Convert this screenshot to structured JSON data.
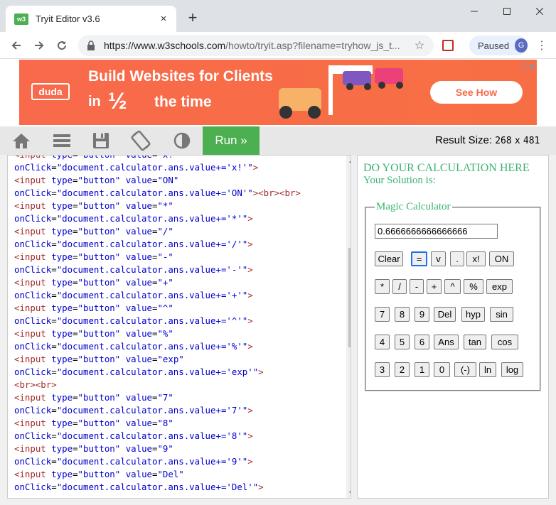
{
  "browser": {
    "tab_title": "Tryit Editor v3.6",
    "favicon_text": "w3",
    "tab_close": "×",
    "new_tab": "+",
    "url_host": "https://www.w3schools.com",
    "url_path": "/howto/tryit.asp?filename=tryhow_js_t...",
    "profile_label": "Paused",
    "profile_initial": "G",
    "icons": [
      "back-icon",
      "forward-icon",
      "reload-icon",
      "lock-icon",
      "star-icon",
      "extension-icon",
      "menu-icon",
      "minimize-icon",
      "maximize-icon",
      "close-icon"
    ]
  },
  "ad": {
    "logo": "duda",
    "line1": "Build Websites for Clients",
    "in": "in",
    "half": "½",
    "rest": "the time",
    "cta": "See How",
    "info": "ⓘ✕",
    "color": "#f86e44"
  },
  "tryit": {
    "run_label": "Run »",
    "result_size_label": "Result Size:",
    "result_width": "268",
    "result_x": "x",
    "result_height": "481",
    "accent": "#4caf50",
    "icons": [
      "home-icon",
      "menu-icon",
      "save-icon",
      "rotate-icon",
      "contrast-icon"
    ]
  },
  "code_lines": [
    [
      [
        "c-tag",
        "<input "
      ],
      [
        "c-attr",
        "type"
      ],
      [
        "c-plain",
        "="
      ],
      [
        "c-attr",
        "\"button\""
      ],
      [
        "c-plain",
        " "
      ],
      [
        "c-attr",
        "value"
      ],
      [
        "c-plain",
        "="
      ],
      [
        "c-attr",
        "\"x!\""
      ]
    ],
    [
      [
        "c-attr",
        "onClick"
      ],
      [
        "c-plain",
        "="
      ],
      [
        "c-attr",
        "\"document.calculator.ans.value+='x!'\""
      ],
      [
        "c-tag",
        ">"
      ]
    ],
    [
      [
        "c-tag",
        "<input "
      ],
      [
        "c-attr",
        "type"
      ],
      [
        "c-plain",
        "="
      ],
      [
        "c-attr",
        "\"button\""
      ],
      [
        "c-plain",
        " "
      ],
      [
        "c-attr",
        "value"
      ],
      [
        "c-plain",
        "="
      ],
      [
        "c-attr",
        "\"ON\""
      ]
    ],
    [
      [
        "c-attr",
        "onClick"
      ],
      [
        "c-plain",
        "="
      ],
      [
        "c-attr",
        "\"document.calculator.ans.value+='ON'\""
      ],
      [
        "c-tag",
        "><br><br>"
      ]
    ],
    [
      [
        "c-tag",
        "<input "
      ],
      [
        "c-attr",
        "type"
      ],
      [
        "c-plain",
        "="
      ],
      [
        "c-attr",
        "\"button\""
      ],
      [
        "c-plain",
        " "
      ],
      [
        "c-attr",
        "value"
      ],
      [
        "c-plain",
        "="
      ],
      [
        "c-attr",
        "\"*\""
      ]
    ],
    [
      [
        "c-attr",
        "onClick"
      ],
      [
        "c-plain",
        "="
      ],
      [
        "c-attr",
        "\"document.calculator.ans.value+='*'\""
      ],
      [
        "c-tag",
        ">"
      ]
    ],
    [
      [
        "c-tag",
        "<input "
      ],
      [
        "c-attr",
        "type"
      ],
      [
        "c-plain",
        "="
      ],
      [
        "c-attr",
        "\"button\""
      ],
      [
        "c-plain",
        " "
      ],
      [
        "c-attr",
        "value"
      ],
      [
        "c-plain",
        "="
      ],
      [
        "c-attr",
        "\"/\""
      ]
    ],
    [
      [
        "c-attr",
        "onClick"
      ],
      [
        "c-plain",
        "="
      ],
      [
        "c-attr",
        "\"document.calculator.ans.value+='/'\""
      ],
      [
        "c-tag",
        ">"
      ]
    ],
    [
      [
        "c-tag",
        "<input "
      ],
      [
        "c-attr",
        "type"
      ],
      [
        "c-plain",
        "="
      ],
      [
        "c-attr",
        "\"button\""
      ],
      [
        "c-plain",
        " "
      ],
      [
        "c-attr",
        "value"
      ],
      [
        "c-plain",
        "="
      ],
      [
        "c-attr",
        "\"-\""
      ]
    ],
    [
      [
        "c-attr",
        "onClick"
      ],
      [
        "c-plain",
        "="
      ],
      [
        "c-attr",
        "\"document.calculator.ans.value+='-'\""
      ],
      [
        "c-tag",
        ">"
      ]
    ],
    [
      [
        "c-tag",
        "<input "
      ],
      [
        "c-attr",
        "type"
      ],
      [
        "c-plain",
        "="
      ],
      [
        "c-attr",
        "\"button\""
      ],
      [
        "c-plain",
        " "
      ],
      [
        "c-attr",
        "value"
      ],
      [
        "c-plain",
        "="
      ],
      [
        "c-attr",
        "\"+\""
      ]
    ],
    [
      [
        "c-attr",
        "onClick"
      ],
      [
        "c-plain",
        "="
      ],
      [
        "c-attr",
        "\"document.calculator.ans.value+='+'\""
      ],
      [
        "c-tag",
        ">"
      ]
    ],
    [
      [
        "c-tag",
        "<input "
      ],
      [
        "c-attr",
        "type"
      ],
      [
        "c-plain",
        "="
      ],
      [
        "c-attr",
        "\"button\""
      ],
      [
        "c-plain",
        " "
      ],
      [
        "c-attr",
        "value"
      ],
      [
        "c-plain",
        "="
      ],
      [
        "c-attr",
        "\"^\""
      ]
    ],
    [
      [
        "c-attr",
        "onClick"
      ],
      [
        "c-plain",
        "="
      ],
      [
        "c-attr",
        "\"document.calculator.ans.value+='^'\""
      ],
      [
        "c-tag",
        ">"
      ]
    ],
    [
      [
        "c-tag",
        "<input "
      ],
      [
        "c-attr",
        "type"
      ],
      [
        "c-plain",
        "="
      ],
      [
        "c-attr",
        "\"button\""
      ],
      [
        "c-plain",
        " "
      ],
      [
        "c-attr",
        "value"
      ],
      [
        "c-plain",
        "="
      ],
      [
        "c-attr",
        "\"%\""
      ]
    ],
    [
      [
        "c-attr",
        "onClick"
      ],
      [
        "c-plain",
        "="
      ],
      [
        "c-attr",
        "\"document.calculator.ans.value+='%'\""
      ],
      [
        "c-tag",
        ">"
      ]
    ],
    [
      [
        "c-tag",
        "<input "
      ],
      [
        "c-attr",
        "type"
      ],
      [
        "c-plain",
        "="
      ],
      [
        "c-attr",
        "\"button\""
      ],
      [
        "c-plain",
        " "
      ],
      [
        "c-attr",
        "value"
      ],
      [
        "c-plain",
        "="
      ],
      [
        "c-attr",
        "\"exp\""
      ]
    ],
    [
      [
        "c-attr",
        "onClick"
      ],
      [
        "c-plain",
        "="
      ],
      [
        "c-attr",
        "\"document.calculator.ans.value+='exp'\""
      ],
      [
        "c-tag",
        ">"
      ]
    ],
    [
      [
        "c-tag",
        "<br><br>"
      ]
    ],
    [
      [
        "c-tag",
        "<input "
      ],
      [
        "c-attr",
        "type"
      ],
      [
        "c-plain",
        "="
      ],
      [
        "c-attr",
        "\"button\""
      ],
      [
        "c-plain",
        " "
      ],
      [
        "c-attr",
        "value"
      ],
      [
        "c-plain",
        "="
      ],
      [
        "c-attr",
        "\"7\""
      ]
    ],
    [
      [
        "c-attr",
        "onClick"
      ],
      [
        "c-plain",
        "="
      ],
      [
        "c-attr",
        "\"document.calculator.ans.value+='7'\""
      ],
      [
        "c-tag",
        ">"
      ]
    ],
    [
      [
        "c-tag",
        "<input "
      ],
      [
        "c-attr",
        "type"
      ],
      [
        "c-plain",
        "="
      ],
      [
        "c-attr",
        "\"button\""
      ],
      [
        "c-plain",
        " "
      ],
      [
        "c-attr",
        "value"
      ],
      [
        "c-plain",
        "="
      ],
      [
        "c-attr",
        "\"8\""
      ]
    ],
    [
      [
        "c-attr",
        "onClick"
      ],
      [
        "c-plain",
        "="
      ],
      [
        "c-attr",
        "\"document.calculator.ans.value+='8'\""
      ],
      [
        "c-tag",
        ">"
      ]
    ],
    [
      [
        "c-tag",
        "<input "
      ],
      [
        "c-attr",
        "type"
      ],
      [
        "c-plain",
        "="
      ],
      [
        "c-attr",
        "\"button\""
      ],
      [
        "c-plain",
        " "
      ],
      [
        "c-attr",
        "value"
      ],
      [
        "c-plain",
        "="
      ],
      [
        "c-attr",
        "\"9\""
      ]
    ],
    [
      [
        "c-attr",
        "onClick"
      ],
      [
        "c-plain",
        "="
      ],
      [
        "c-attr",
        "\"document.calculator.ans.value+='9'\""
      ],
      [
        "c-tag",
        ">"
      ]
    ],
    [
      [
        "c-tag",
        "<input "
      ],
      [
        "c-attr",
        "type"
      ],
      [
        "c-plain",
        "="
      ],
      [
        "c-attr",
        "\"button\""
      ],
      [
        "c-plain",
        " "
      ],
      [
        "c-attr",
        "value"
      ],
      [
        "c-plain",
        "="
      ],
      [
        "c-attr",
        "\"Del\""
      ]
    ],
    [
      [
        "c-attr",
        "onClick"
      ],
      [
        "c-plain",
        "="
      ],
      [
        "c-attr",
        "\"document.calculator.ans.value+='Del'\""
      ],
      [
        "c-tag",
        ">"
      ]
    ]
  ],
  "result": {
    "heading": "DO YOUR CALCULATION HERE",
    "subheading": "Your Solution is:",
    "legend": "Magic Calculator",
    "answer": "0.6666666666666666",
    "text_color": "#3cb371",
    "rows": [
      [
        "Clear",
        "=",
        "v",
        ".",
        "x!",
        "ON"
      ],
      [
        "*",
        "/",
        "-",
        "+",
        "^",
        "%",
        "exp"
      ],
      [
        "7",
        "8",
        "9",
        "Del",
        "hyp",
        "sin"
      ],
      [
        "4",
        "5",
        "6",
        "Ans",
        "tan",
        "cos"
      ],
      [
        "3",
        "2",
        "1",
        "0",
        "(-)",
        "ln",
        "log"
      ]
    ],
    "focused_button": "="
  }
}
